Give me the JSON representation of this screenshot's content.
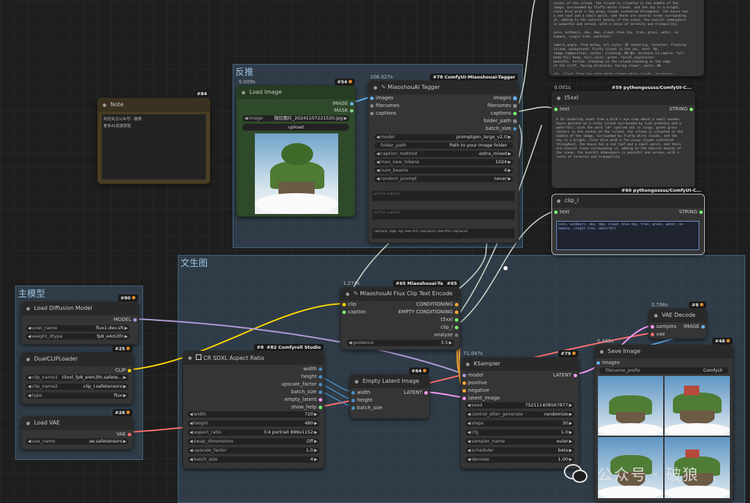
{
  "groups": {
    "fantui": "反推",
    "wenshengtu": "文生图",
    "zhumoxing": "主模型"
  },
  "note": {
    "title": "Note",
    "id": "#84",
    "text": "欢迎关注公众号：破狼\n更多AI资源获取"
  },
  "load_image": {
    "title": "Load Image",
    "id": "#54",
    "time": "0.009s",
    "out_image": "IMAGE",
    "out_mask": "MASK",
    "image_label": "image",
    "image_value": "微信图片_20241107221520.jpg",
    "upload": "upload"
  },
  "tagger": {
    "title": "MiaoshouAI Tagger",
    "id": "#78 ComfyUI-Miaoshouai-Tagger",
    "time": "106.027s",
    "in_images": "images",
    "in_filenames": "filenames",
    "in_captions": "captions",
    "out_images": "images",
    "out_filenames": "filenames",
    "out_captions": "captions",
    "out_folder_path": "folder_path",
    "out_batch_size": "batch_size",
    "model_label": "model",
    "model_value": "promptgen_large_v2.0",
    "folder_label": "folder_path",
    "folder_value": "Path to your image folder",
    "cm_label": "caption_method",
    "cm_value": "extra_mixed",
    "mnt_label": "max_new_tokens",
    "mnt_value": "1024",
    "nb_label": "num_beams",
    "nb_value": "4",
    "rp_label": "random_prompt",
    "rp_value": "never",
    "prefix": "prefix_caption",
    "suffix": "suffix_caption",
    "replace": "replace_tags eg:search1:replace1;search2:replace2"
  },
  "top_text": "center of the island. the island is situated in the middle of the\nimage, surrounded by fluffy white clouds, and the sky is a bright,\nclear blue with a few wispy clouds scattered throughout. the house has\na red roof and a small porch, and there are several trees surrounding\nit, adding to the natural beauty of the scene. the overall atmosphere\nis peaceful and serene, with a sense of serenity and tranquility.\n\nsolo, outdoors, sky, day, cloud, blue sky, tree, grass, water, no\nhumans, single tree, waterfall\n\ncamera_angle: from below, art_style: 3D rendering, location: floating\nisland, background: fluffy clouds in the sky, text: NA,\nimage_composition: center, clothing: NA,NA, distance_to_camera: full\nbody:full body, hair_color: green, facial_expression:\npeaceful, action: standing on the island:standing on the edge\nof the cliff, facing_direction: facing viewer, parts: NA\n\nsky, cloud: blue sky with white clouds:white clouds, accessory:\nnone:NA,NA, shoes: none, action : standing on a small island:holding a\nhouse, facing viewer: sky direction - NA,looking up, sky: lying on",
  "t5xxl": {
    "title": "t5xxl",
    "id": "#59 pythongossss/ComfyUI-C...",
    "time": "0.001s",
    "in": "text",
    "out": "STRING",
    "text": "A 3d rendering shoot from a bird's eye view about a small wooden\nhouse perched on a rocky island surrounded by lush greenery and a\nwaterfall, with the word \"nb\" spelled out in large, green grass\nletters in the center of the island. the island is situated in the\nmiddle of the image, surrounded by fluffy white clouds, and the\nsky is a bright, clear blue with a few wispy clouds scattered\nthroughout. the house has a red roof and a small porch, and there\nare several trees surrounding it, adding to the natural beauty of\nthe scene. the overall atmosphere is peaceful and serene, with a\nsense of serenity and tranquility."
  },
  "clip_l": {
    "title": "clip_l",
    "id": "#60 pythongossss/ComfyUI-C...",
    "in": "text",
    "out": "STRING",
    "text": "solo, outdoors, sky, day, cloud, blue sky, tree, grass, water, no\nhumans, single tree, waterfall"
  },
  "flux_encode": {
    "title": "MiaoshouAI Flux Clip Text Encode",
    "id": "#65 Miaoshouai-Ta",
    "id2": "#65",
    "time": "1.274s",
    "in_clip": "clip",
    "in_caption": "caption",
    "out_cond": "CONDITIONING",
    "out_empty": "EMPTY CONDITIONING",
    "out_t5": "t5xxl",
    "out_clip": "clip_l",
    "out_analyze": "analyze",
    "guidance_label": "guidance",
    "guidance_value": "3.5"
  },
  "load_diffusion": {
    "title": "Load Diffusion Model",
    "id": "#80",
    "out": "MODEL",
    "unet_label": "unet_name",
    "unet_value": "flux1-dev.sft",
    "wd_label": "weight_dtype",
    "wd_value": "fp8_e4m3fn"
  },
  "dualclip": {
    "title": "DualCLIPLoader",
    "id": "#25",
    "out": "CLIP",
    "c1_label": "clip_name1",
    "c1_value": "t5xxl_fp8_e4m3fn.safete...",
    "c2_label": "clip_name2",
    "c2_value": "clip_l.safetensors",
    "type_label": "type",
    "type_value": "flux"
  },
  "load_vae": {
    "title": "Load VAE",
    "id": "#26",
    "out": "VAE",
    "vae_label": "vae_name",
    "vae_value": "ae.safetensors"
  },
  "crsdxl": {
    "title": "CR SDXL Aspect Ratio",
    "id": "#82 Comfyroll Studio",
    "id_short": "#82 Cor",
    "outs": [
      "width",
      "height",
      "upscale_factor",
      "batch_size",
      "empty_latent",
      "show_help"
    ],
    "widgets": [
      {
        "l": "width",
        "v": "720"
      },
      {
        "l": "height",
        "v": "480"
      },
      {
        "l": "aspect_ratio",
        "v": "3:4 portrait 896x1152"
      },
      {
        "l": "swap_dimensions",
        "v": "Off"
      },
      {
        "l": "upscale_factor",
        "v": "1.0"
      },
      {
        "l": "batch_size",
        "v": "4"
      }
    ]
  },
  "empty_latent": {
    "title": "Empty Latent Image",
    "id": "#64",
    "in_width": "width",
    "in_height": "height",
    "in_batch": "batch_size",
    "out": "LATENT"
  },
  "ksampler": {
    "title": "KSampler",
    "id": "#79",
    "time": "71.047s",
    "ins": [
      "model",
      "positive",
      "negative",
      "latent_image"
    ],
    "out": "LATENT",
    "widgets": [
      {
        "l": "seed",
        "v": "752111408567877"
      },
      {
        "l": "control_after_generate",
        "v": "randomize"
      },
      {
        "l": "steps",
        "v": "30"
      },
      {
        "l": "cfg",
        "v": "1.0"
      },
      {
        "l": "sampler_name",
        "v": "euler"
      },
      {
        "l": "scheduler",
        "v": "beta"
      },
      {
        "l": "denoise",
        "v": "1.00"
      }
    ]
  },
  "vae_decode": {
    "title": "VAE Decode",
    "id": "#8",
    "time": "0.706s",
    "in_samples": "samples",
    "in_vae": "vae",
    "out": "IMAGE"
  },
  "save_image": {
    "title": "Save Image",
    "id": "#48",
    "time": "0.465s",
    "in": "images",
    "fp_label": "filename_prefix",
    "fp_value": "ComfyUI"
  },
  "watermark": "公众号 · 破狼",
  "colors": {
    "clip": "#ffd500",
    "model": "#b39ddb",
    "vae": "#ff6e6e",
    "latent": "#ff9cf9",
    "image": "#64b5f6",
    "conditioning": "#ffa931",
    "string": "#77ff77",
    "int": "#4a90c8"
  }
}
